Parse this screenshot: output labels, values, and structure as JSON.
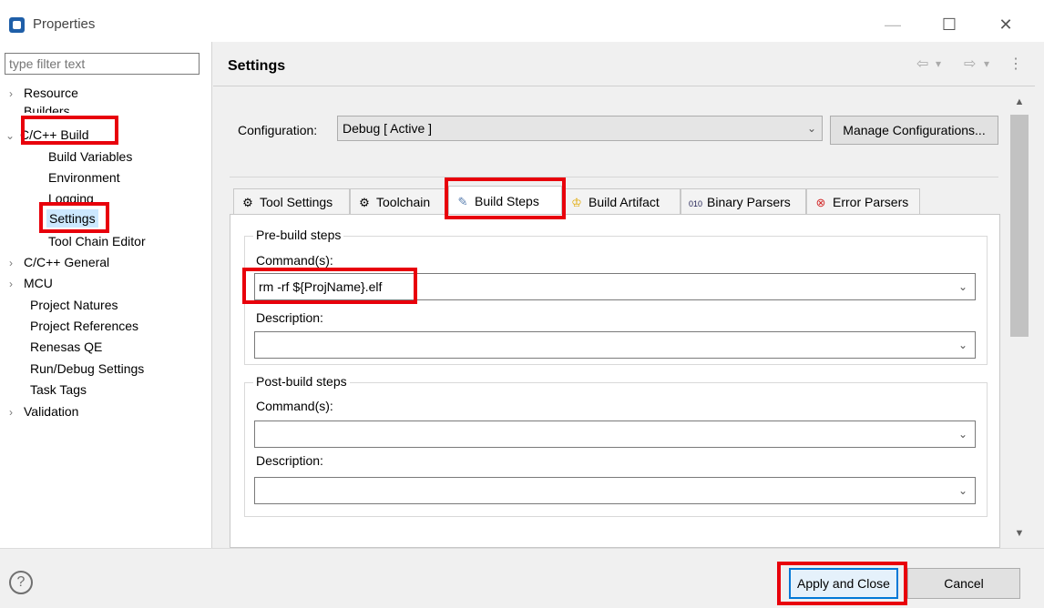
{
  "window": {
    "title": "Properties",
    "minimize": "—",
    "maximize": "☐",
    "close": "✕"
  },
  "filter": {
    "placeholder": "type filter text"
  },
  "tree": [
    {
      "label": "Resource",
      "twisty": "›"
    },
    {
      "label": "Builders"
    },
    {
      "label": "C/C++ Build",
      "twisty": "⌄"
    },
    {
      "label": "Build Variables"
    },
    {
      "label": "Environment"
    },
    {
      "label": "Logging"
    },
    {
      "label": "Settings",
      "selected": true
    },
    {
      "label": "Tool Chain Editor"
    },
    {
      "label": "C/C++ General",
      "twisty": "›"
    },
    {
      "label": "MCU",
      "twisty": "›"
    },
    {
      "label": "Project Natures"
    },
    {
      "label": "Project References"
    },
    {
      "label": "Renesas QE"
    },
    {
      "label": "Run/Debug Settings"
    },
    {
      "label": "Task Tags"
    },
    {
      "label": "Validation",
      "twisty": "›"
    }
  ],
  "page": {
    "title": "Settings",
    "nav": {
      "back": "⇦",
      "back_menu": "▾",
      "forward": "⇨",
      "forward_menu": "▾",
      "more": "⋮"
    }
  },
  "configuration": {
    "label": "Configuration:",
    "value": "Debug  [ Active ]",
    "manage_button": "Manage Configurations..."
  },
  "tabs": [
    {
      "label": "Tool Settings",
      "icon": "gear-icon"
    },
    {
      "label": "Toolchain",
      "icon": "gear-icon"
    },
    {
      "label": "Build Steps",
      "icon": "brush-icon",
      "active": true
    },
    {
      "label": "Build Artifact",
      "icon": "artifact-icon"
    },
    {
      "label": "Binary Parsers",
      "icon": "binary-icon"
    },
    {
      "label": "Error Parsers",
      "icon": "error-icon"
    }
  ],
  "prebuild": {
    "legend": "Pre-build steps",
    "command_label": "Command(s):",
    "command_value": "rm -rf ${ProjName}.elf",
    "description_label": "Description:",
    "description_value": ""
  },
  "postbuild": {
    "legend": "Post-build steps",
    "command_label": "Command(s):",
    "command_value": "",
    "description_label": "Description:",
    "description_value": ""
  },
  "buttons": {
    "help": "?",
    "apply": "Apply and Close",
    "cancel": "Cancel"
  },
  "colors": {
    "highlight": "#e8000b",
    "focus": "#0078d7",
    "thumb": "#c2c2c2"
  }
}
